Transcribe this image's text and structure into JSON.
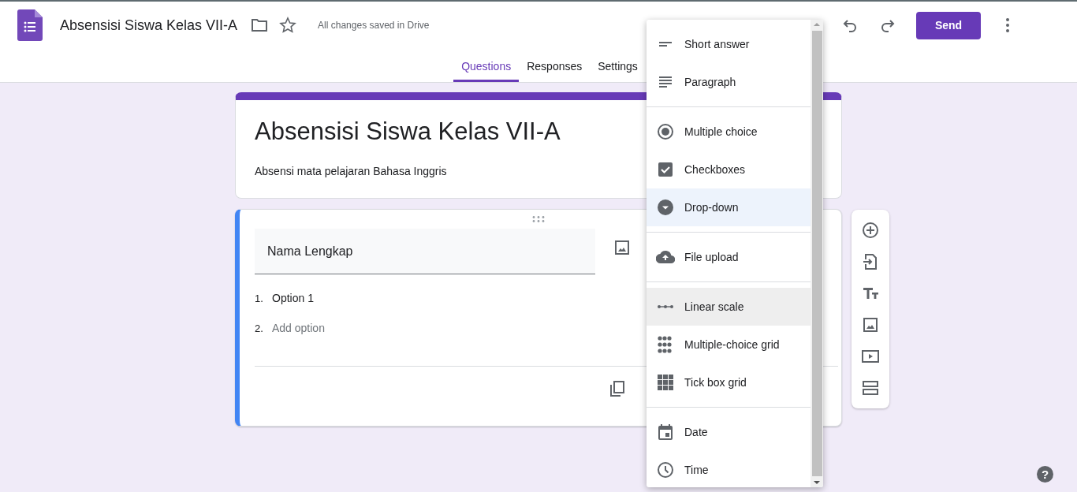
{
  "help_button": "?",
  "header": {
    "title": "Absensisi Siswa Kelas VII-A",
    "save_status": "All changes saved in Drive",
    "send_button": "Send"
  },
  "tabs": [
    {
      "label": "Questions",
      "selected": true
    },
    {
      "label": "Responses",
      "selected": false
    },
    {
      "label": "Settings",
      "selected": false
    }
  ],
  "form_header": {
    "title": "Absensisi Siswa Kelas VII-A",
    "description": "Absensi mata pelajaran Bahasa Inggris"
  },
  "question": {
    "title": "Nama Lengkap",
    "options": [
      {
        "number": "1.",
        "label": "Option 1",
        "kind": "option"
      },
      {
        "number": "2.",
        "label": "Add option",
        "kind": "add"
      }
    ]
  },
  "type_menu": {
    "groups": [
      {
        "items": [
          {
            "label": "Short answer",
            "kind": "short",
            "selected": false,
            "hovered": false
          },
          {
            "label": "Paragraph",
            "kind": "paragraph",
            "selected": false,
            "hovered": false
          }
        ]
      },
      {
        "items": [
          {
            "label": "Multiple choice",
            "kind": "radio",
            "selected": false,
            "hovered": false
          },
          {
            "label": "Checkboxes",
            "kind": "checkbox",
            "selected": false,
            "hovered": false
          },
          {
            "label": "Drop-down",
            "kind": "dropdown",
            "selected": true,
            "hovered": false
          }
        ]
      },
      {
        "items": [
          {
            "label": "File upload",
            "kind": "upload",
            "selected": false,
            "hovered": false
          }
        ]
      },
      {
        "items": [
          {
            "label": "Linear scale",
            "kind": "scale",
            "selected": false,
            "hovered": true
          },
          {
            "label": "Multiple-choice grid",
            "kind": "radiogrid",
            "selected": false,
            "hovered": false
          },
          {
            "label": "Tick box grid",
            "kind": "tickgrid",
            "selected": false,
            "hovered": false
          }
        ]
      },
      {
        "items": [
          {
            "label": "Date",
            "kind": "date",
            "selected": false,
            "hovered": false
          },
          {
            "label": "Time",
            "kind": "time",
            "selected": false,
            "hovered": false
          }
        ]
      }
    ]
  }
}
